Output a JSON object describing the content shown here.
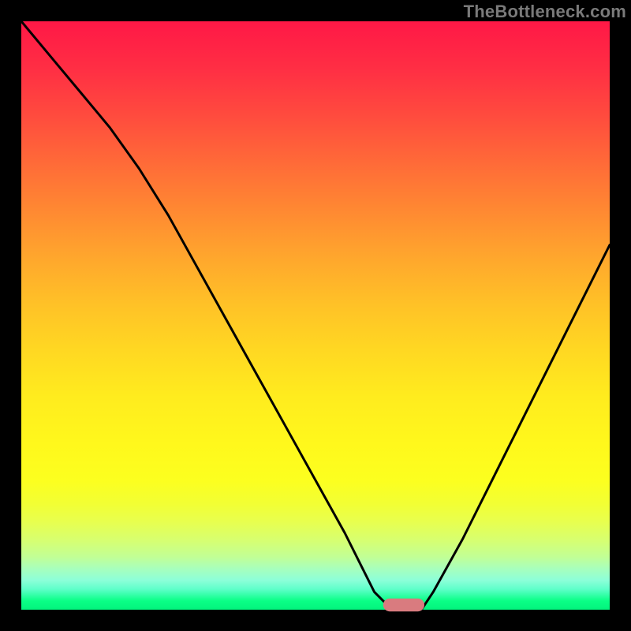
{
  "watermark": "TheBottleneck.com",
  "chart_data": {
    "type": "line",
    "title": "",
    "xlabel": "",
    "ylabel": "",
    "xlim": [
      0,
      100
    ],
    "ylim": [
      0,
      100
    ],
    "grid": false,
    "legend": false,
    "series": [
      {
        "name": "bottleneck-curve",
        "x": [
          0,
          5,
          10,
          15,
          20,
          25,
          30,
          35,
          40,
          45,
          50,
          55,
          58,
          60,
          62,
          64,
          66,
          68,
          70,
          75,
          80,
          85,
          90,
          95,
          100
        ],
        "y": [
          100,
          94,
          88,
          82,
          75,
          67,
          58,
          49,
          40,
          31,
          22,
          13,
          7,
          3,
          1,
          0,
          0,
          0,
          3,
          12,
          22,
          32,
          42,
          52,
          62
        ],
        "color": "#000000"
      }
    ],
    "annotations": [
      {
        "name": "sweet-spot-marker",
        "type": "capsule",
        "x_center": 65,
        "y_center": 0.8,
        "width": 7,
        "height": 2.2,
        "color": "#d97b7f"
      }
    ],
    "background_gradient": {
      "top": "#ff1846",
      "mid": "#ffe020",
      "bottom": "#03f37d"
    }
  }
}
